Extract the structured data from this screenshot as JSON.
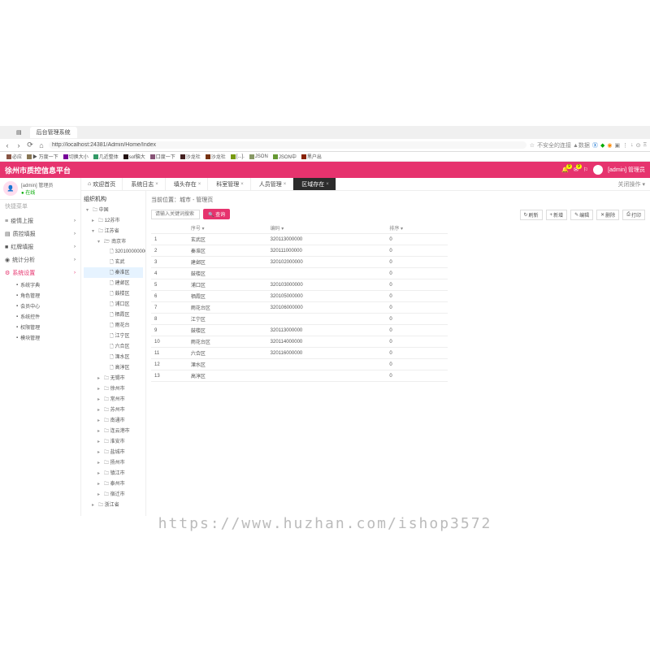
{
  "browser": {
    "tab_title": "后台管理系统",
    "url": "http://localhost:24381/Admin/Home/Index",
    "right_text": "不安全的连接 ▲数据",
    "bookmarks": [
      "必应",
      "▶ 万度一下",
      "切换大小",
      "几近整体",
      "sof脑大",
      "口度一下",
      "沙龙社",
      "沙龙社",
      "[...].",
      "JSON",
      "JSON中",
      "黑户出"
    ]
  },
  "header": {
    "title": "徐州市质控信息平台",
    "user": "[admin] 管理员"
  },
  "sidebar": {
    "user_name": "[admin] 管理员",
    "user_status": "● 在线",
    "shortcut": "快捷菜单",
    "items": [
      {
        "label": "疫情上报",
        "icon": "≡"
      },
      {
        "label": "质控填报",
        "icon": "▤"
      },
      {
        "label": "红牌填报",
        "icon": "■"
      },
      {
        "label": "统计分析",
        "icon": "◉"
      },
      {
        "label": "系统设置",
        "icon": "⚙",
        "active": true
      }
    ],
    "sub_items": [
      {
        "label": "系统字典"
      },
      {
        "label": "角色管理"
      },
      {
        "label": "会员中心"
      },
      {
        "label": "系统控件"
      },
      {
        "label": "权限管理"
      },
      {
        "label": "模块管理"
      }
    ]
  },
  "tabs": [
    {
      "label": "欢迎首页",
      "closable": false
    },
    {
      "label": "系统日志",
      "closable": true
    },
    {
      "label": "填头存在",
      "closable": true
    },
    {
      "label": "科室管理",
      "closable": true
    },
    {
      "label": "人员管理",
      "closable": true
    },
    {
      "label": "区域存在",
      "closable": true,
      "active": true
    }
  ],
  "tab_more": "关闭操作 ▾",
  "tree": {
    "title": "组织机构",
    "root": "中国",
    "province": "江苏省",
    "prov_code": "12苏市",
    "city": "南京市",
    "city_code": "320100000000",
    "districts": [
      "玄武",
      "秦淮区",
      "建邺区",
      "鼓楼区",
      "浦口区",
      "栖霞区",
      "雨花台",
      "江宁区",
      "六合区",
      "溧水区",
      "高淳区"
    ],
    "other_cities": [
      "无锡市",
      "徐州市",
      "常州市",
      "苏州市",
      "南通市",
      "连云港市",
      "淮安市",
      "盐城市",
      "扬州市",
      "镇江市",
      "泰州市",
      "宿迁市"
    ],
    "other_prov": "浙江省"
  },
  "breadcrumb": "当前位置：城市 - 管理页",
  "search": {
    "placeholder": "请输入关键词搜索",
    "btn": "查询"
  },
  "toolbar": [
    {
      "label": "刷新",
      "icon": "↻"
    },
    {
      "label": "新增",
      "icon": "+"
    },
    {
      "label": "编辑",
      "icon": "✎"
    },
    {
      "label": "删除",
      "icon": "✕"
    },
    {
      "label": "打印",
      "icon": "⎙"
    }
  ],
  "table": {
    "headers": [
      "序号",
      "编码",
      "排序"
    ],
    "rows": [
      {
        "n": 1,
        "name": "玄武区",
        "code": "320113000000",
        "sort": 0
      },
      {
        "n": 2,
        "name": "秦淮区",
        "code": "320111000000",
        "sort": 0
      },
      {
        "n": 3,
        "name": "建邺区",
        "code": "320102000000",
        "sort": 0
      },
      {
        "n": 4,
        "name": "鼓楼区",
        "code": "",
        "sort": 0
      },
      {
        "n": 5,
        "name": "浦口区",
        "code": "320103000000",
        "sort": 0
      },
      {
        "n": 6,
        "name": "栖霞区",
        "code": "320105000000",
        "sort": 0
      },
      {
        "n": 7,
        "name": "雨花台区",
        "code": "320106000000",
        "sort": 0
      },
      {
        "n": 8,
        "name": "江宁区",
        "code": "",
        "sort": 0
      },
      {
        "n": 9,
        "name": "鼓楼区",
        "code": "320113000000",
        "sort": 0
      },
      {
        "n": 10,
        "name": "雨花台区",
        "code": "320114000000",
        "sort": 0
      },
      {
        "n": 11,
        "name": "六合区",
        "code": "320116000000",
        "sort": 0
      },
      {
        "n": 12,
        "name": "溧水区",
        "code": "",
        "sort": 0
      },
      {
        "n": 13,
        "name": "高淳区",
        "code": "",
        "sort": 0
      }
    ]
  },
  "watermark": "https://www.huzhan.com/ishop3572"
}
